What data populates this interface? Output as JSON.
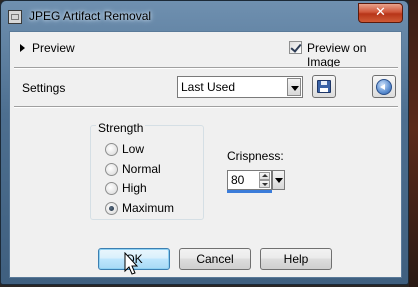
{
  "window": {
    "title": "JPEG Artifact Removal",
    "close_glyph": "✕"
  },
  "preview": {
    "label": "Preview",
    "preview_on_image_label": "Preview on Image",
    "preview_on_image_checked": true
  },
  "settings": {
    "label": "Settings",
    "selected": "Last Used",
    "save_icon": "floppy-disk-icon",
    "reset_icon": "reset-arrow-icon"
  },
  "strength": {
    "title": "Strength",
    "options": [
      "Low",
      "Normal",
      "High",
      "Maximum"
    ],
    "selected": "Maximum"
  },
  "crispness": {
    "label": "Crispness:",
    "value": "80"
  },
  "buttons": {
    "ok": "OK",
    "cancel": "Cancel",
    "help": "Help"
  },
  "colors": {
    "title_bar": "#4d6f90",
    "close_button": "#c9452a",
    "default_button": "#bee6fd",
    "client_background": "#f0f0f0"
  }
}
